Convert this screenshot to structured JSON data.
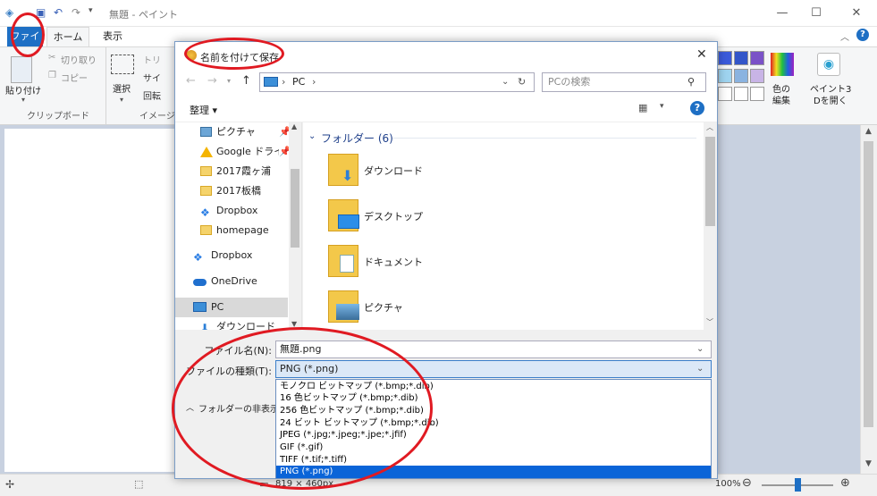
{
  "paint": {
    "window_title": "無題 - ペイント",
    "minimize": "—",
    "maximize": "☐",
    "close": "✕",
    "tabs": {
      "file": "ファイル",
      "home": "ホーム",
      "view": "表示"
    },
    "ribbon": {
      "paste": "貼り付け",
      "cut": "切り取り",
      "copy": "コピー",
      "clipboard_group": "クリップボード",
      "select": "選択",
      "crop": "トリ",
      "resize": "サイ",
      "rotate": "回転",
      "image_group": "イメージ",
      "edit_colors": "色の\n編集",
      "edit_colors_l1": "色の",
      "edit_colors_l2": "編集",
      "paint3d_l1": "ペイント3",
      "paint3d_l2": "Dを開く"
    },
    "status": {
      "size": "819 × 460px",
      "zoom": "100%"
    }
  },
  "dialog": {
    "title": "名前を付けて保存",
    "address_root": "PC",
    "search_placeholder": "PCの検索",
    "organize": "整理 ▾",
    "nav_items": [
      {
        "label": "ピクチャ",
        "icon": "pictures-icon"
      },
      {
        "label": "Google ドライブ",
        "icon": "google-drive-icon"
      },
      {
        "label": "2017霞ヶ浦",
        "icon": "folder-icon"
      },
      {
        "label": "2017板橋",
        "icon": "folder-icon"
      },
      {
        "label": "Dropbox",
        "icon": "dropbox-icon"
      },
      {
        "label": "homepage",
        "icon": "folder-icon"
      },
      {
        "label": "Dropbox",
        "icon": "dropbox-icon"
      },
      {
        "label": "OneDrive",
        "icon": "onedrive-icon"
      },
      {
        "label": "PC",
        "icon": "pc-icon"
      },
      {
        "label": "ダウンロード",
        "icon": "download-icon"
      }
    ],
    "group_header": "フォルダー (6)",
    "folders": [
      {
        "label": "ダウンロード",
        "icon": "download-folder-icon"
      },
      {
        "label": "デスクトップ",
        "icon": "desktop-folder-icon"
      },
      {
        "label": "ドキュメント",
        "icon": "documents-folder-icon"
      },
      {
        "label": "ピクチャ",
        "icon": "pictures-folder-icon"
      }
    ],
    "filename_label": "ファイル名(N):",
    "filename_value": "無題.png",
    "filetype_label": "ファイルの種類(T):",
    "filetype_value": "PNG (*.png)",
    "hide_folders": "フォルダーの非表示",
    "filetype_options": [
      "モノクロ ビットマップ (*.bmp;*.dib)",
      "16 色ビットマップ (*.bmp;*.dib)",
      "256 色ビットマップ (*.bmp;*.dib)",
      "24 ビット ビットマップ (*.bmp;*.dib)",
      "JPEG (*.jpg;*.jpeg;*.jpe;*.jfif)",
      "GIF (*.gif)",
      "TIFF (*.tif;*.tiff)",
      "PNG (*.png)"
    ],
    "selected_index": 7
  },
  "colors": {
    "accent": "#1e6fc4",
    "highlight": "#0a64d8",
    "annotation": "#e01a22"
  }
}
